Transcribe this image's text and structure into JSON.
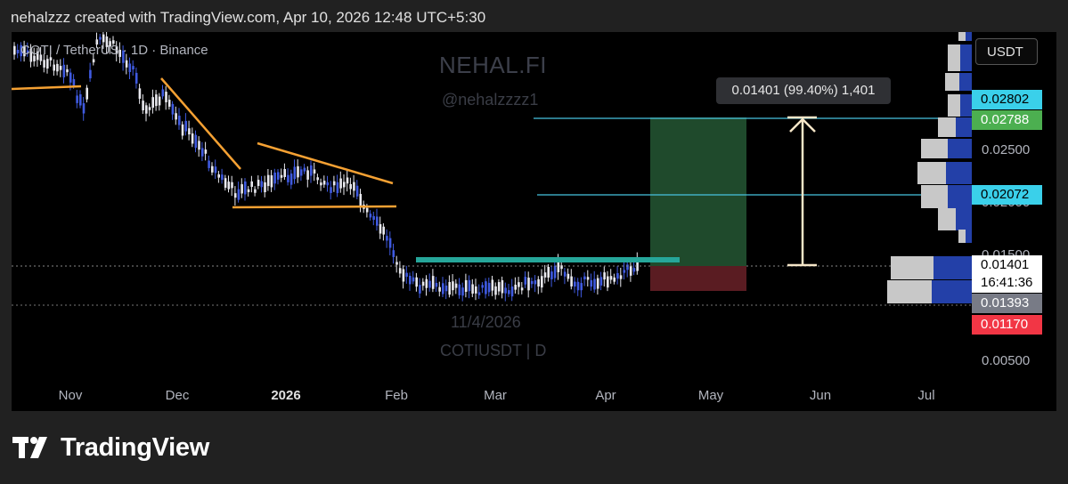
{
  "header": {
    "caption": "nehalzzz created with TradingView.com, Apr 10, 2026 12:48 UTC+5:30"
  },
  "chart": {
    "symbol_label": "COTI / TetherUS · 1D · Binance",
    "watermark_title": "NEHAL.FI",
    "watermark_handle": "@nehalzzzz1",
    "watermark_date": "11/4/2026",
    "watermark_ticker": "COTIUSDT | D",
    "currency": "USDT",
    "measure_label": "0.01401 (99.40%) 1,401",
    "price_ticks": [
      "0.02500",
      "0.02000",
      "0.01500",
      "0.00500"
    ],
    "time_ticks": [
      {
        "label": "Nov",
        "bold": false
      },
      {
        "label": "Dec",
        "bold": false
      },
      {
        "label": "2026",
        "bold": true
      },
      {
        "label": "Feb",
        "bold": false
      },
      {
        "label": "Mar",
        "bold": false
      },
      {
        "label": "Apr",
        "bold": false
      },
      {
        "label": "May",
        "bold": false
      },
      {
        "label": "Jun",
        "bold": false
      },
      {
        "label": "Jul",
        "bold": false
      }
    ],
    "price_badges": {
      "level_top": "0.02802",
      "target": "0.02788",
      "level_mid": "0.02072",
      "current_price": "0.01401",
      "countdown": "16:41:36",
      "stop_area": "0.01393",
      "stop": "0.01170"
    },
    "colors": {
      "bg": "#000000",
      "candle_up": "#3f5ae0",
      "candle_down": "#e8e8ee",
      "trendline": "#f5a133",
      "level_line": "#47c2e0",
      "entry_line": "#26a69a",
      "profit_zone": "#1f4a2c",
      "loss_zone": "#5a1c22",
      "target_badge": "#4caf50",
      "stop_badge": "#f23645",
      "cyan_badge": "#3ad0ea"
    }
  },
  "footer": {
    "brand": "TradingView"
  }
}
